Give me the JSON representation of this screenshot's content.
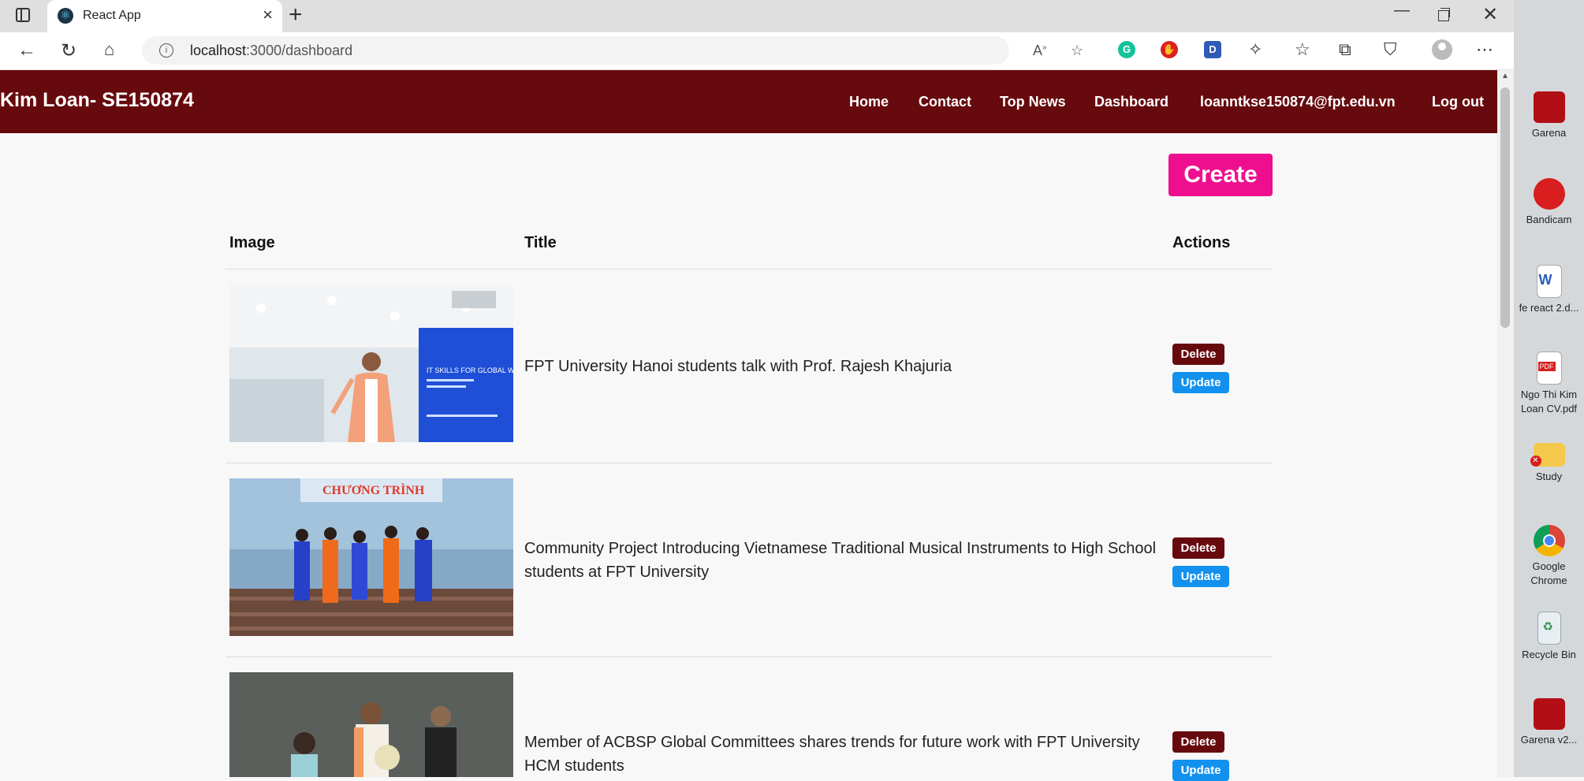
{
  "browser": {
    "tab_title": "React App",
    "url_host": "localhost",
    "url_path": ":3000/dashboard"
  },
  "navbar": {
    "brand": "Kim Loan- SE150874",
    "links": [
      "Home",
      "Contact",
      "Top News",
      "Dashboard",
      "loanntkse150874@fpt.edu.vn",
      "Log out"
    ]
  },
  "dashboard": {
    "create_label": "Create",
    "columns": [
      "Image",
      "Title",
      "Actions"
    ],
    "delete_label": "Delete",
    "update_label": "Update",
    "rows": [
      {
        "title": "FPT University Hanoi students talk with Prof. Rajesh Khajuria"
      },
      {
        "title": "Community Project Introducing Vietnamese Traditional Musical Instruments to High School students at FPT University"
      },
      {
        "title": "Member of ACBSP Global Committees shares trends for future work with FPT University HCM students"
      }
    ]
  },
  "thumbnails": {
    "slide_text": "IT SKILLS FOR GLOBAL WORKFORCE",
    "banner_text": "CHƯƠNG TRÌNH"
  },
  "desktop": {
    "icons": [
      "Garena",
      "Bandicam",
      "fe react 2.d...",
      "Ngo Thi Kim Loan CV.pdf",
      "Study",
      "Google Chrome",
      "Recycle Bin",
      "Garena v2..."
    ]
  },
  "colors": {
    "navbar": "#670a0e",
    "create": "#ef0f8e",
    "delete": "#670a0e",
    "update": "#1291ee"
  }
}
